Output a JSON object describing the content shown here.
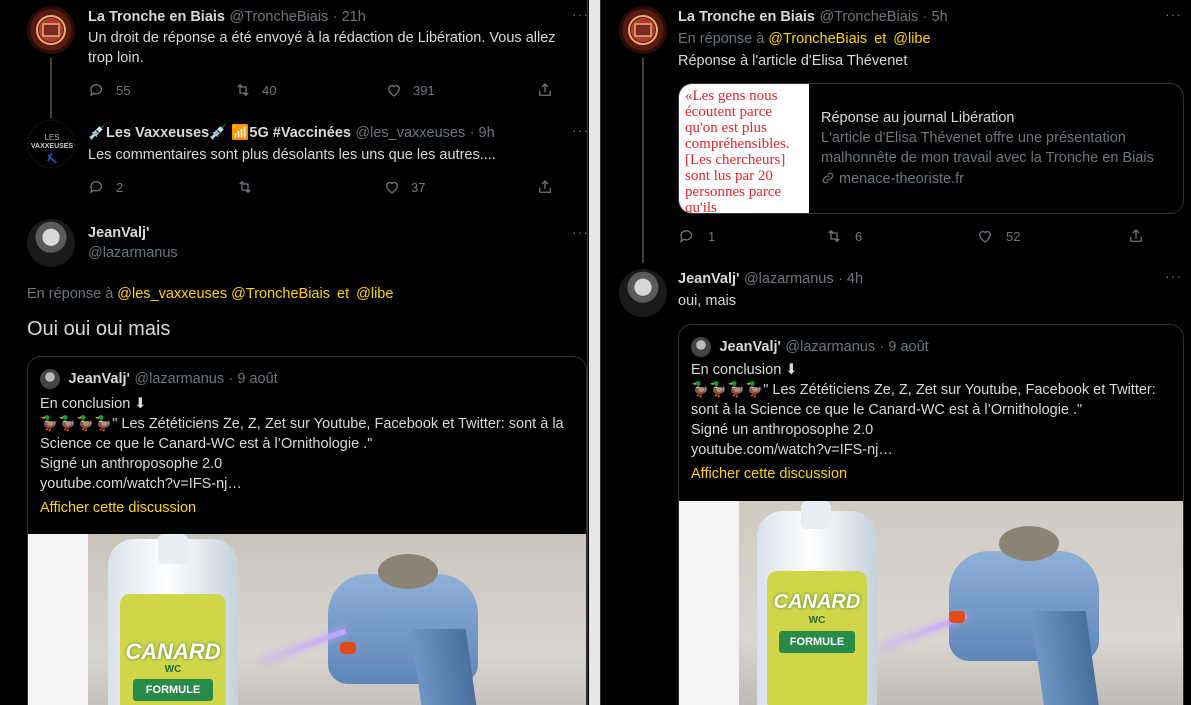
{
  "left": {
    "tweet1": {
      "name": "La Tronche en Biais",
      "handle": "@TroncheBiais",
      "time": "· 21h",
      "text": "Un droit de réponse a été envoyé à la rédaction de Libération. Vous allez trop loin.",
      "replies": "55",
      "retweets": "40",
      "likes": "391"
    },
    "tweet2": {
      "name": "💉Les Vaxxeuses💉 📶5G #Vaccinées",
      "handle": "@les_vaxxeuses",
      "time": "· 9h",
      "text": "Les commentaires sont plus désolants les uns que les autres....",
      "replies": "2",
      "retweets": "",
      "likes": "37",
      "avatar_text_1": "LES",
      "avatar_text_2": "VAXXEUSES"
    },
    "main": {
      "name": "JeanValj'",
      "handle": "@lazarmanus",
      "reply_prefix": "En réponse à",
      "mention1": "@les_vaxxeuses",
      "mention2": "@TroncheBiais",
      "reply_and": "et",
      "mention3": "@libe",
      "text": "Oui oui oui mais"
    },
    "quote": {
      "name": "JeanValj'",
      "handle": "@lazarmanus",
      "time": "· 9 août",
      "line1": "En conclusion ⬇",
      "line2": "🦆🦆🦆🦆\" Les Zététiciens Ze, Z, Zet sur Youtube, Facebook et Twitter: sont à la Science ce que le Canard-WC est à l’Ornithologie .\"",
      "line3": "Signé un anthroposophe 2.0",
      "line4": "youtube.com/watch?v=IFS-nj…",
      "show_thread": "Afficher cette discussion"
    }
  },
  "right": {
    "tweet1": {
      "name": "La Tronche en Biais",
      "handle": "@TroncheBiais",
      "time": "· 5h",
      "reply_prefix": "En réponse à",
      "mention1": "@TroncheBiais",
      "reply_and": "et",
      "mention2": "@libe",
      "text": "Réponse à l'article d'Elisa Thévenet",
      "card_title": "Réponse au journal Libération",
      "card_desc": "L'article d'Elisa Thévenet offre une présentation malhonnête de mon travail avec la Tronche en Biais",
      "card_domain": "menace-theoriste.fr",
      "card_image_text": "«Les gens nous écoutent parce qu'on est plus compréhensibles. [Les chercheurs] sont lus par 20 personnes parce qu'ils",
      "replies": "1",
      "retweets": "6",
      "likes": "52"
    },
    "tweet2": {
      "name": "JeanValj'",
      "handle": "@lazarmanus",
      "time": "· 4h",
      "text": "oui, mais"
    },
    "quote": {
      "name": "JeanValj'",
      "handle": "@lazarmanus",
      "time": "· 9 août",
      "line1": "En conclusion ⬇",
      "line2": "🦆🦆🦆🦆\" Les Zététiciens Ze, Z, Zet sur Youtube, Facebook et Twitter: sont à la Science ce que le Canard-WC est à l’Ornithologie .\"",
      "line3": "Signé un anthroposophe 2.0",
      "line4": "youtube.com/watch?v=IFS-nj…",
      "show_thread": "Afficher cette discussion"
    }
  },
  "media_labels": {
    "brand": "CANARD",
    "sub": "WC",
    "formula": "FORMULE"
  },
  "more_icon": "···",
  "colors": {
    "background": "#000000",
    "link": "#ffd400",
    "muted": "#6e767d",
    "text": "#d9d9d9"
  }
}
